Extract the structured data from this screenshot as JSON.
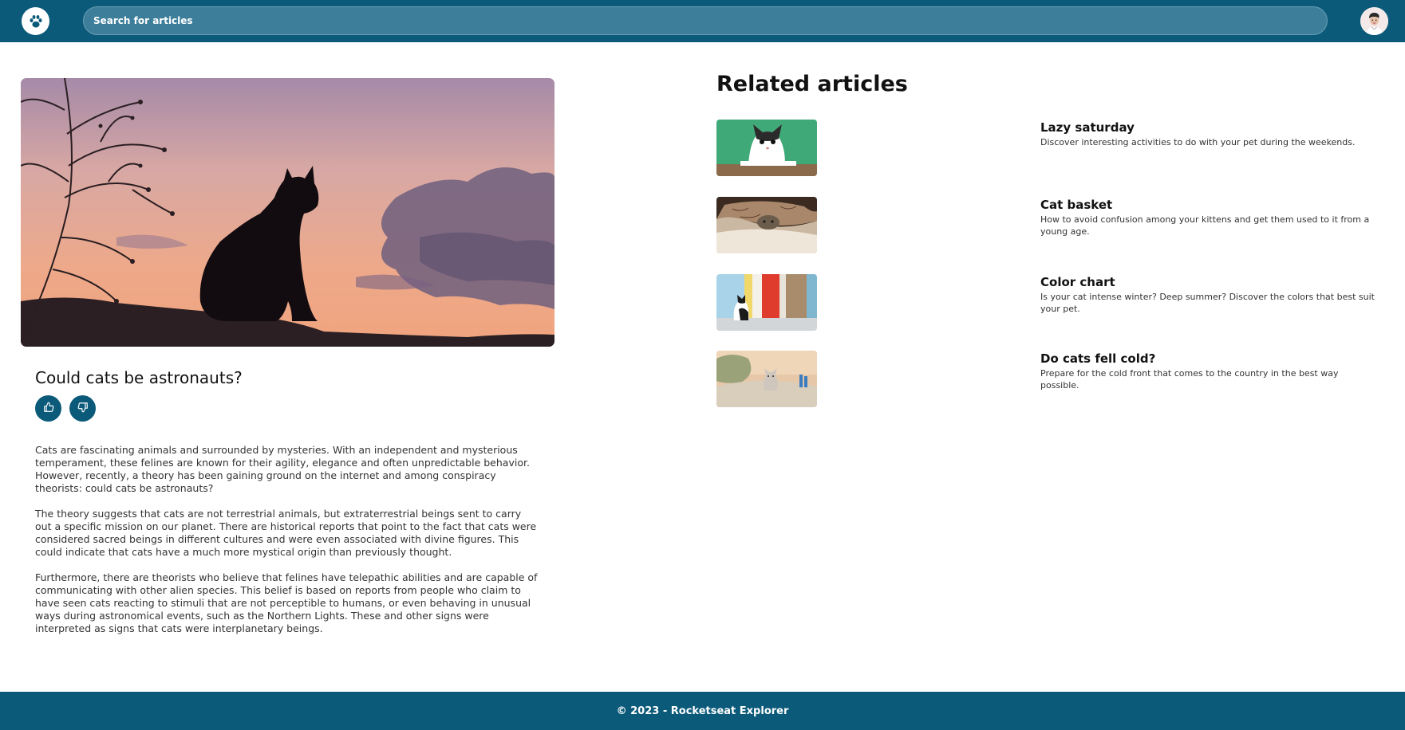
{
  "header": {
    "logo_icon": "paw-icon",
    "search": {
      "placeholder": "Search for articles",
      "value": ""
    },
    "avatar_icon": "user-avatar"
  },
  "article": {
    "title": "Could cats be astronauts?",
    "like_icon": "thumbs-up-icon",
    "dislike_icon": "thumbs-down-icon",
    "paragraphs": [
      "Cats are fascinating animals and surrounded by mysteries. With an independent and mysterious temperament, these felines are known for their agility, elegance and often unpredictable behavior. However, recently, a theory has been gaining ground on the internet and among conspiracy theorists: could cats be astronauts?",
      "The theory suggests that cats are not terrestrial animals, but extraterrestrial beings sent to carry out a specific mission on our planet. There are historical reports that point to the fact that cats were considered sacred beings in different cultures and were even associated with divine figures. This could indicate that cats have a much more mystical origin than previously thought.",
      "Furthermore, there are theorists who believe that felines have telepathic abilities and are capable of communicating with other alien species. This belief is based on reports from people who claim to have seen cats reacting to stimuli that are not perceptible to humans, or even behaving in unusual ways during astronomical events, such as the Northern Lights. These and other signs were interpreted as signs that cats were interplanetary beings."
    ]
  },
  "related": {
    "heading": "Related articles",
    "items": [
      {
        "title": "Lazy saturday",
        "description": "Discover interesting activities to do with your pet during the weekends."
      },
      {
        "title": "Cat basket",
        "description": "How to avoid confusion among your kittens and get them used to it from a young age."
      },
      {
        "title": "Color chart",
        "description": "Is your cat intense winter? Deep summer? Discover the colors that best suit your pet."
      },
      {
        "title": "Do cats fell cold?",
        "description": "Prepare for the cold front that comes to the country in the best way possible."
      }
    ]
  },
  "footer": {
    "text": "© 2023 - Rocketseat Explorer"
  },
  "colors": {
    "primary": "#0b5a7a",
    "search_bg": "#3d7f9b"
  }
}
